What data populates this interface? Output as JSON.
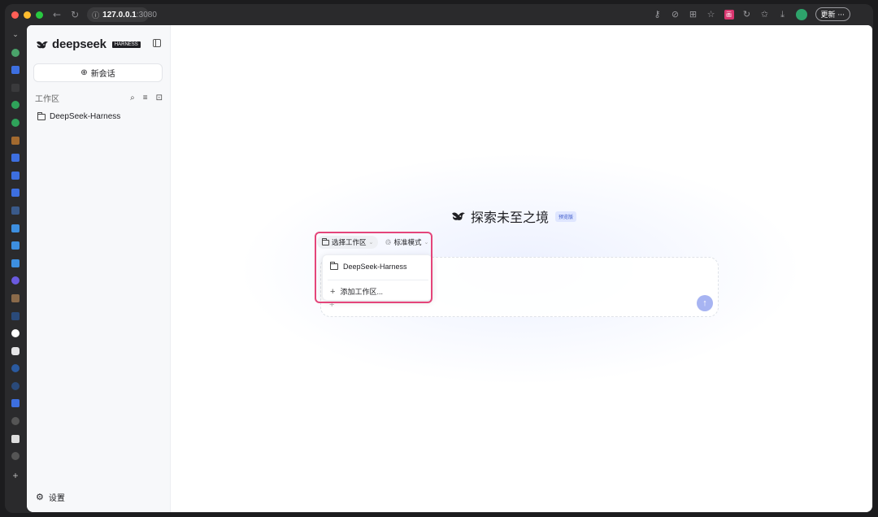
{
  "browser": {
    "url_host": "127.0.0.1",
    "url_port": ":3080",
    "update_label": "更新"
  },
  "sidebar": {
    "brand": "deepseek",
    "brand_badge": "HARNESS",
    "new_chat_label": "新会话",
    "workspace_header": "工作区",
    "workspaces": [
      {
        "label": "DeepSeek-Harness"
      }
    ],
    "settings_label": "设置"
  },
  "main": {
    "hero_title": "探索未至之境",
    "hero_badge": "预览版",
    "select_workspace_label": "选择工作区",
    "mode_label": "标准模式",
    "dropdown": {
      "items": [
        {
          "label": "DeepSeek-Harness"
        },
        {
          "label": "添加工作区..."
        }
      ]
    }
  },
  "colors": {
    "accent": "#a7b4f2",
    "highlight": "#e4457a",
    "badge_bg": "#dfe6ff"
  }
}
